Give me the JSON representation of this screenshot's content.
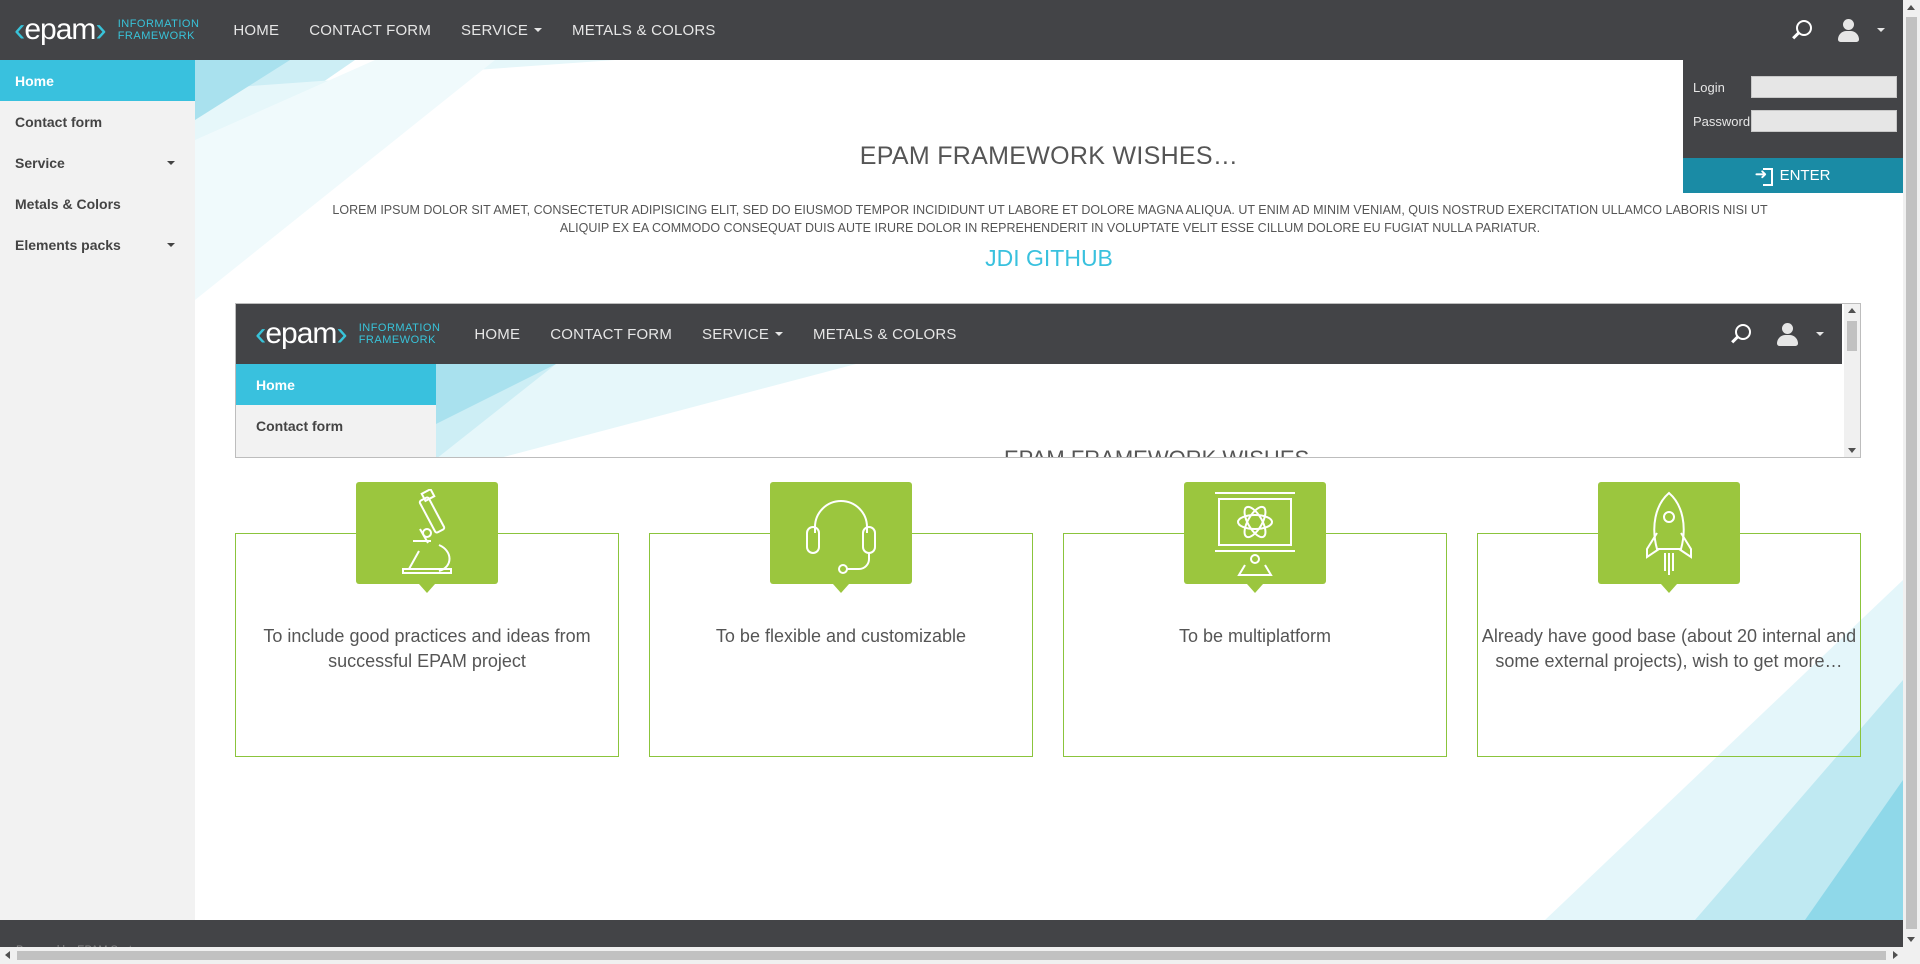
{
  "header": {
    "logo_text": "epam",
    "logo_sub_1": "INFORMATION",
    "logo_sub_2": "FRAMEWORK",
    "nav": [
      "HOME",
      "CONTACT FORM",
      "SERVICE",
      "METALS & COLORS"
    ]
  },
  "sidebar": {
    "items": [
      "Home",
      "Contact form",
      "Service",
      "Metals & Colors",
      "Elements packs"
    ]
  },
  "login": {
    "login_label": "Login",
    "password_label": "Password",
    "login_value": "",
    "password_value": "",
    "enter_label": "ENTER"
  },
  "main": {
    "title": "EPAM FRAMEWORK WISHES…",
    "text": "LOREM IPSUM DOLOR SIT AMET, CONSECTETUR ADIPISICING ELIT, SED DO EIUSMOD TEMPOR INCIDIDUNT UT LABORE ET DOLORE MAGNA ALIQUA. UT ENIM AD MINIM VENIAM, QUIS NOSTRUD EXERCITATION ULLAMCO LABORIS NISI UT ALIQUIP EX EA COMMODO CONSEQUAT DUIS AUTE IRURE DOLOR IN REPREHENDERIT IN VOLUPTATE VELIT ESSE CILLUM DOLORE EU FUGIAT NULLA PARIATUR.",
    "github_link": "JDI GITHUB"
  },
  "iframe": {
    "logo_text": "epam",
    "logo_sub_1": "INFORMATION",
    "logo_sub_2": "FRAMEWORK",
    "nav": [
      "HOME",
      "CONTACT FORM",
      "SERVICE",
      "METALS & COLORS"
    ],
    "sidebar_items": [
      "Home",
      "Contact form"
    ],
    "partial_title": "EPAM FRAMEWORK WISHES…"
  },
  "benefits": [
    {
      "icon": "microscope-icon",
      "text": "To include good practices and ideas from successful EPAM project"
    },
    {
      "icon": "headset-icon",
      "text": "To be flexible and customizable"
    },
    {
      "icon": "monitor-atom-icon",
      "text": "To be multiplatform"
    },
    {
      "icon": "rocket-icon",
      "text": "Already have good base (about 20 internal and some external projects), wish to get more…"
    }
  ],
  "footer": {
    "text": "Powered by EPAM System"
  },
  "colors": {
    "header_bg": "#434447",
    "accent": "#39c1de",
    "enter_bg": "#1a8ba5",
    "benefit_green": "#9bc63e"
  }
}
